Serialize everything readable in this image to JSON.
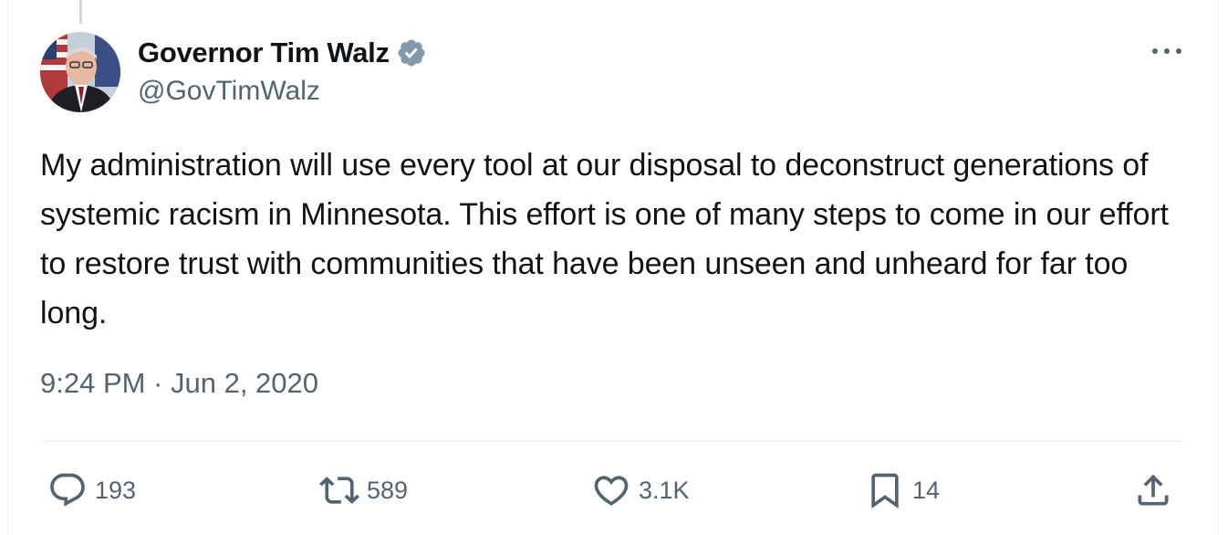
{
  "author": {
    "name": "Governor Tim Walz",
    "handle": "@GovTimWalz",
    "verified_badge_color": "#829aab",
    "avatar_icon": "avatar-photo"
  },
  "tweet": {
    "text": "My administration will use every tool at our disposal to deconstruct generations of systemic racism in Minnesota. This effort is one of many steps to come in our effort to restore trust with communities that have been unseen and unheard for far too long.",
    "timestamp": "9:24 PM · Jun 2, 2020"
  },
  "actions": {
    "reply": {
      "icon": "reply-icon",
      "count": "193"
    },
    "retweet": {
      "icon": "retweet-icon",
      "count": "589"
    },
    "like": {
      "icon": "heart-icon",
      "count": "3.1K"
    },
    "bookmark": {
      "icon": "bookmark-icon",
      "count": "14"
    },
    "share": {
      "icon": "share-icon"
    }
  },
  "menu": {
    "icon": "more-icon"
  },
  "colors": {
    "text": "#0f1419",
    "secondary": "#536471",
    "divider": "#eff3f4"
  }
}
